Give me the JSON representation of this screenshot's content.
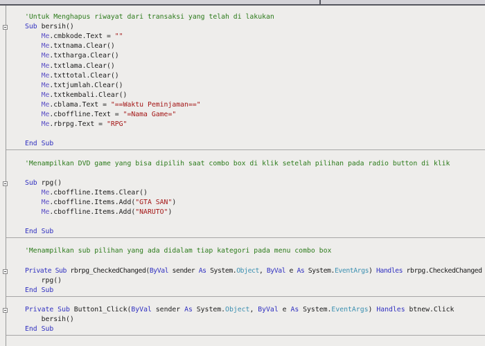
{
  "editor": {
    "lines": [
      [
        {
          "t": "'Untuk Menghapus riwayat dari transaksi yang telah di lakukan",
          "c": "cm"
        }
      ],
      [
        {
          "t": "Sub",
          "c": "kw"
        },
        {
          "t": " bersih()",
          "c": ""
        }
      ],
      [
        {
          "t": "    ",
          "c": ""
        },
        {
          "t": "Me",
          "c": "me"
        },
        {
          "t": ".cmbkode.Text = ",
          "c": ""
        },
        {
          "t": "\"\"",
          "c": "str"
        }
      ],
      [
        {
          "t": "    ",
          "c": ""
        },
        {
          "t": "Me",
          "c": "me"
        },
        {
          "t": ".txtnama.Clear()",
          "c": ""
        }
      ],
      [
        {
          "t": "    ",
          "c": ""
        },
        {
          "t": "Me",
          "c": "me"
        },
        {
          "t": ".txtharga.Clear()",
          "c": ""
        }
      ],
      [
        {
          "t": "    ",
          "c": ""
        },
        {
          "t": "Me",
          "c": "me"
        },
        {
          "t": ".txtlama.Clear()",
          "c": ""
        }
      ],
      [
        {
          "t": "    ",
          "c": ""
        },
        {
          "t": "Me",
          "c": "me"
        },
        {
          "t": ".txttotal.Clear()",
          "c": ""
        }
      ],
      [
        {
          "t": "    ",
          "c": ""
        },
        {
          "t": "Me",
          "c": "me"
        },
        {
          "t": ".txtjumlah.Clear()",
          "c": ""
        }
      ],
      [
        {
          "t": "    ",
          "c": ""
        },
        {
          "t": "Me",
          "c": "me"
        },
        {
          "t": ".txtkembali.Clear()",
          "c": ""
        }
      ],
      [
        {
          "t": "    ",
          "c": ""
        },
        {
          "t": "Me",
          "c": "me"
        },
        {
          "t": ".cblama.Text = ",
          "c": ""
        },
        {
          "t": "\"==Waktu Peminjaman==\"",
          "c": "str"
        }
      ],
      [
        {
          "t": "    ",
          "c": ""
        },
        {
          "t": "Me",
          "c": "me"
        },
        {
          "t": ".cboffline.Text = ",
          "c": ""
        },
        {
          "t": "\"=Nama Game=\"",
          "c": "str"
        }
      ],
      [
        {
          "t": "    ",
          "c": ""
        },
        {
          "t": "Me",
          "c": "me"
        },
        {
          "t": ".rbrpg.Text = ",
          "c": ""
        },
        {
          "t": "\"RPG\"",
          "c": "str"
        }
      ],
      [],
      [
        {
          "t": "End Sub",
          "c": "kw"
        }
      ],
      [],
      [
        {
          "t": "'Menampilkan DVD game yang bisa dipilih saat combo box di klik setelah pilihan pada radio button di klik",
          "c": "cm"
        }
      ],
      [],
      [
        {
          "t": "Sub",
          "c": "kw"
        },
        {
          "t": " rpg()",
          "c": ""
        }
      ],
      [
        {
          "t": "    ",
          "c": ""
        },
        {
          "t": "Me",
          "c": "me"
        },
        {
          "t": ".cboffline.Items.Clear()",
          "c": ""
        }
      ],
      [
        {
          "t": "    ",
          "c": ""
        },
        {
          "t": "Me",
          "c": "me"
        },
        {
          "t": ".cboffline.Items.Add(",
          "c": ""
        },
        {
          "t": "\"GTA SAN\"",
          "c": "str"
        },
        {
          "t": ")",
          "c": ""
        }
      ],
      [
        {
          "t": "    ",
          "c": ""
        },
        {
          "t": "Me",
          "c": "me"
        },
        {
          "t": ".cboffline.Items.Add(",
          "c": ""
        },
        {
          "t": "\"NARUTO\"",
          "c": "str"
        },
        {
          "t": ")",
          "c": ""
        }
      ],
      [],
      [
        {
          "t": "End Sub",
          "c": "kw"
        }
      ],
      [],
      [
        {
          "t": "'Menampilkan sub pilihan yang ada didalam tiap kategori pada menu combo box",
          "c": "cm"
        }
      ],
      [],
      [
        {
          "t": "Private Sub",
          "c": "kw"
        },
        {
          "t": " rbrpg_CheckedChanged(",
          "c": ""
        },
        {
          "t": "ByVal",
          "c": "kw"
        },
        {
          "t": " sender ",
          "c": ""
        },
        {
          "t": "As",
          "c": "kw"
        },
        {
          "t": " System.",
          "c": ""
        },
        {
          "t": "Object",
          "c": "ty"
        },
        {
          "t": ", ",
          "c": ""
        },
        {
          "t": "ByVal",
          "c": "kw"
        },
        {
          "t": " e ",
          "c": ""
        },
        {
          "t": "As",
          "c": "kw"
        },
        {
          "t": " System.",
          "c": ""
        },
        {
          "t": "EventArgs",
          "c": "ty"
        },
        {
          "t": ") ",
          "c": ""
        },
        {
          "t": "Handles",
          "c": "kw"
        },
        {
          "t": " rbrpg.CheckedChanged",
          "c": ""
        }
      ],
      [
        {
          "t": "    rpg()",
          "c": ""
        }
      ],
      [
        {
          "t": "End Sub",
          "c": "kw"
        }
      ],
      [],
      [
        {
          "t": "Private Sub",
          "c": "kw"
        },
        {
          "t": " Button1_Click(",
          "c": ""
        },
        {
          "t": "ByVal",
          "c": "kw"
        },
        {
          "t": " sender ",
          "c": ""
        },
        {
          "t": "As",
          "c": "kw"
        },
        {
          "t": " System.",
          "c": ""
        },
        {
          "t": "Object",
          "c": "ty"
        },
        {
          "t": ", ",
          "c": ""
        },
        {
          "t": "ByVal",
          "c": "kw"
        },
        {
          "t": " e ",
          "c": ""
        },
        {
          "t": "As",
          "c": "kw"
        },
        {
          "t": " System.",
          "c": ""
        },
        {
          "t": "EventArgs",
          "c": "ty"
        },
        {
          "t": ") ",
          "c": ""
        },
        {
          "t": "Handles",
          "c": "kw"
        },
        {
          "t": " btnew.Click",
          "c": ""
        }
      ],
      [
        {
          "t": "    bersih()",
          "c": ""
        }
      ],
      [
        {
          "t": "End Sub",
          "c": "kw"
        }
      ]
    ],
    "colors": {
      "keyword": "#2f2fc0",
      "string": "#a31515",
      "comment": "#2b7a1a",
      "type": "#3a8fb0",
      "background": "#eeedeb"
    }
  }
}
